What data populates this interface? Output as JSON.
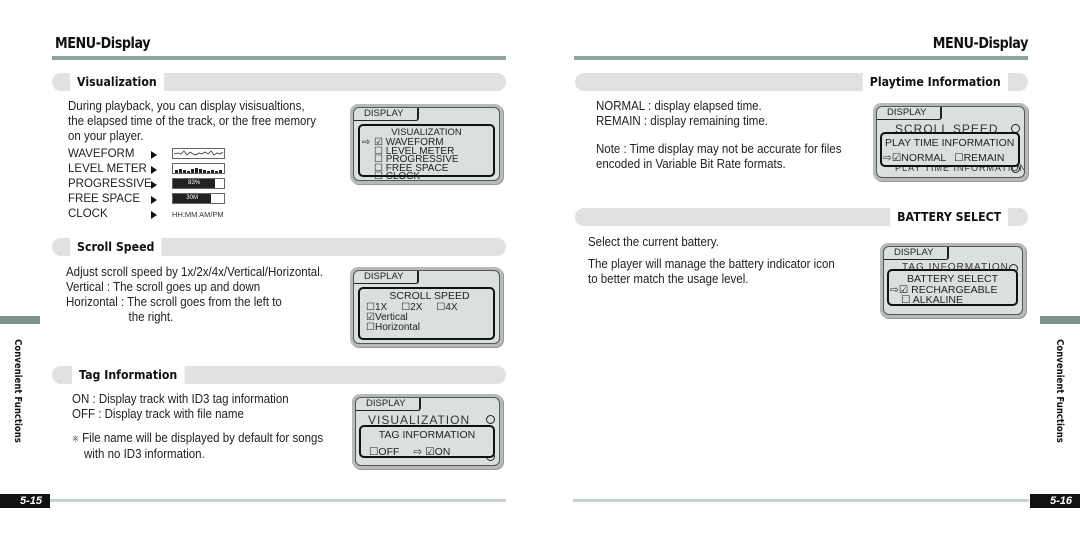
{
  "left_page": {
    "title": "MENU-Display",
    "side_label": "Convenient Functions",
    "page_number": "5-15",
    "sections": {
      "visualization": {
        "title": "Visualization",
        "description": [
          "During playback, you can display visisualtions,",
          "the elapsed time of the track, or the free memory",
          "on your player."
        ],
        "items": [
          {
            "label": "WAVEFORM",
            "preview": "waveform"
          },
          {
            "label": "LEVEL METER",
            "preview": "level-meter"
          },
          {
            "label": "PROGRESSIVE",
            "preview": "bar",
            "value": "83%",
            "fill": 0.83
          },
          {
            "label": "FREE SPACE",
            "preview": "bar",
            "value": "30M",
            "fill": 0.75
          },
          {
            "label": "CLOCK",
            "preview": "text",
            "value": "HH:MM AM/PM"
          }
        ],
        "lcd": {
          "tab": "DISPLAY",
          "heading": "VISUALIZATION",
          "options": [
            {
              "label": "WAVEFORM",
              "checked": true,
              "selected": true
            },
            {
              "label": "LEVEL  METER",
              "checked": false
            },
            {
              "label": "PROGRESSIVE",
              "checked": false
            },
            {
              "label": "FREE  SPACE",
              "checked": false
            },
            {
              "label": "CLOCK",
              "checked": false
            }
          ]
        }
      },
      "scroll_speed": {
        "title": "Scroll Speed",
        "description": [
          "Adjust scroll speed by 1x/2x/4x/Vertical/Horizontal.",
          "Vertical : The scroll goes up and down",
          "Horizontal : The scroll goes from the left to",
          "the right."
        ],
        "lcd": {
          "tab": "DISPLAY",
          "heading": "SCROLL SPEED",
          "options": [
            {
              "label": "1X",
              "checked": false
            },
            {
              "label": "2X",
              "checked": false
            },
            {
              "label": "4X",
              "checked": false
            },
            {
              "label": "Vertical",
              "checked": true
            },
            {
              "label": "Horizontal",
              "checked": false
            }
          ]
        }
      },
      "tag_information": {
        "title": "Tag Information",
        "description": [
          "ON : Display track with ID3 tag information",
          "OFF : Display track with file name"
        ],
        "note_symbol": "※",
        "note": [
          "File name will be displayed by default for songs",
          "with no ID3 information."
        ],
        "lcd": {
          "tab": "DISPLAY",
          "background_item": "VISUALIZATION",
          "heading": "TAG INFORMATION",
          "options": [
            {
              "label": "OFF",
              "checked": false
            },
            {
              "label": "ON",
              "checked": true,
              "selected": true
            }
          ]
        }
      }
    }
  },
  "right_page": {
    "title": "MENU-Display",
    "side_label": "Convenient Functions",
    "page_number": "5-16",
    "sections": {
      "playtime_information": {
        "title": "Playtime Information",
        "description": [
          "NORMAL : display elapsed time.",
          "REMAIN : display remaining time."
        ],
        "note": [
          "Note : Time display may not be accurate for files",
          "encoded in Variable Bit Rate formats."
        ],
        "lcd": {
          "tab": "DISPLAY",
          "background_item": "SCROLL SPEED",
          "background_item_bottom": "PLAY TIME INFORMATION",
          "heading": "PLAY TIME INFORMATION",
          "options": [
            {
              "label": "NORMAL",
              "checked": true,
              "selected": true
            },
            {
              "label": "REMAIN",
              "checked": false
            }
          ]
        }
      },
      "battery_select": {
        "title": "BATTERY SELECT",
        "description": [
          "Select the current battery."
        ],
        "description2": [
          "The player will manage the battery indicator icon",
          "to better match the usage level."
        ],
        "lcd": {
          "tab": "DISPLAY",
          "background_item": "TAG INFORMATION",
          "heading": "BATTERY SELECT",
          "options": [
            {
              "label": "RECHARGEABLE",
              "checked": true,
              "selected": true
            },
            {
              "label": "ALKALINE",
              "checked": false
            }
          ]
        }
      }
    }
  },
  "glyphs": {
    "checked_box": "☑",
    "empty_box": "☐",
    "select_arrow": "⇨"
  }
}
